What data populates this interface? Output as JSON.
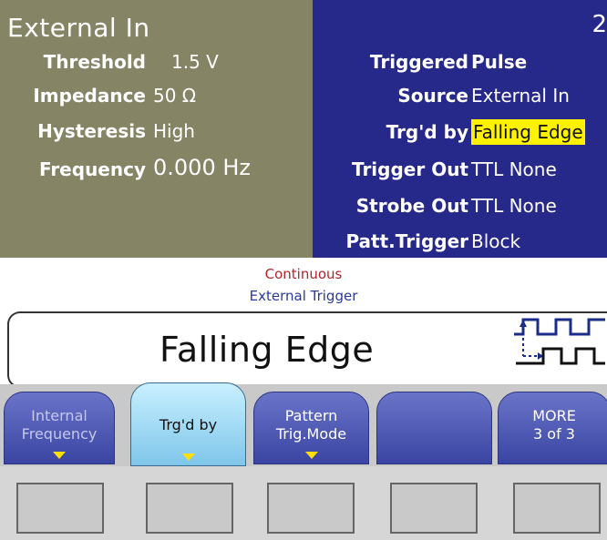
{
  "left_panel": {
    "title": "External In",
    "rows": [
      {
        "label": "Threshold",
        "value": "1.5 V"
      },
      {
        "label": "Impedance",
        "value": "50 Ω"
      },
      {
        "label": "Hysteresis",
        "value": "High"
      },
      {
        "label": "Frequency",
        "value": "0.000 Hz"
      }
    ]
  },
  "right_panel": {
    "page_number": "2",
    "rows": [
      {
        "label": "Triggered",
        "value": "Pulse"
      },
      {
        "label": "Source",
        "value": "External In"
      },
      {
        "label": "Trg'd by",
        "value": "Falling Edge"
      },
      {
        "label": "Trigger Out",
        "value": "TTL  None"
      },
      {
        "label": "Strobe Out",
        "value": "TTL  None"
      },
      {
        "label": "Patt.Trigger",
        "value": "Block"
      }
    ],
    "highlight_color": "#fff200"
  },
  "status": {
    "line1": "Continuous",
    "line2": "External Trigger"
  },
  "display": {
    "big_text": "Falling Edge",
    "icon": "falling-edge-waveform-icon"
  },
  "softkeys": [
    {
      "line1": "Internal",
      "line2": "Frequency",
      "state": "disabled"
    },
    {
      "line1": "Trg'd by",
      "line2": "",
      "state": "active"
    },
    {
      "line1": "Pattern",
      "line2": "Trig.Mode",
      "state": "normal"
    },
    {
      "line1": "",
      "line2": "",
      "state": "normal"
    },
    {
      "line1": "MORE",
      "line2": "3 of 3",
      "state": "normal"
    }
  ],
  "colors": {
    "left_panel_bg": "#858465",
    "right_panel_bg": "#26288a",
    "softkey_blue": "#3a45a3",
    "softkey_active": "#7fc6ea",
    "status_red": "#b4232b",
    "status_blue": "#2a3a9a"
  }
}
